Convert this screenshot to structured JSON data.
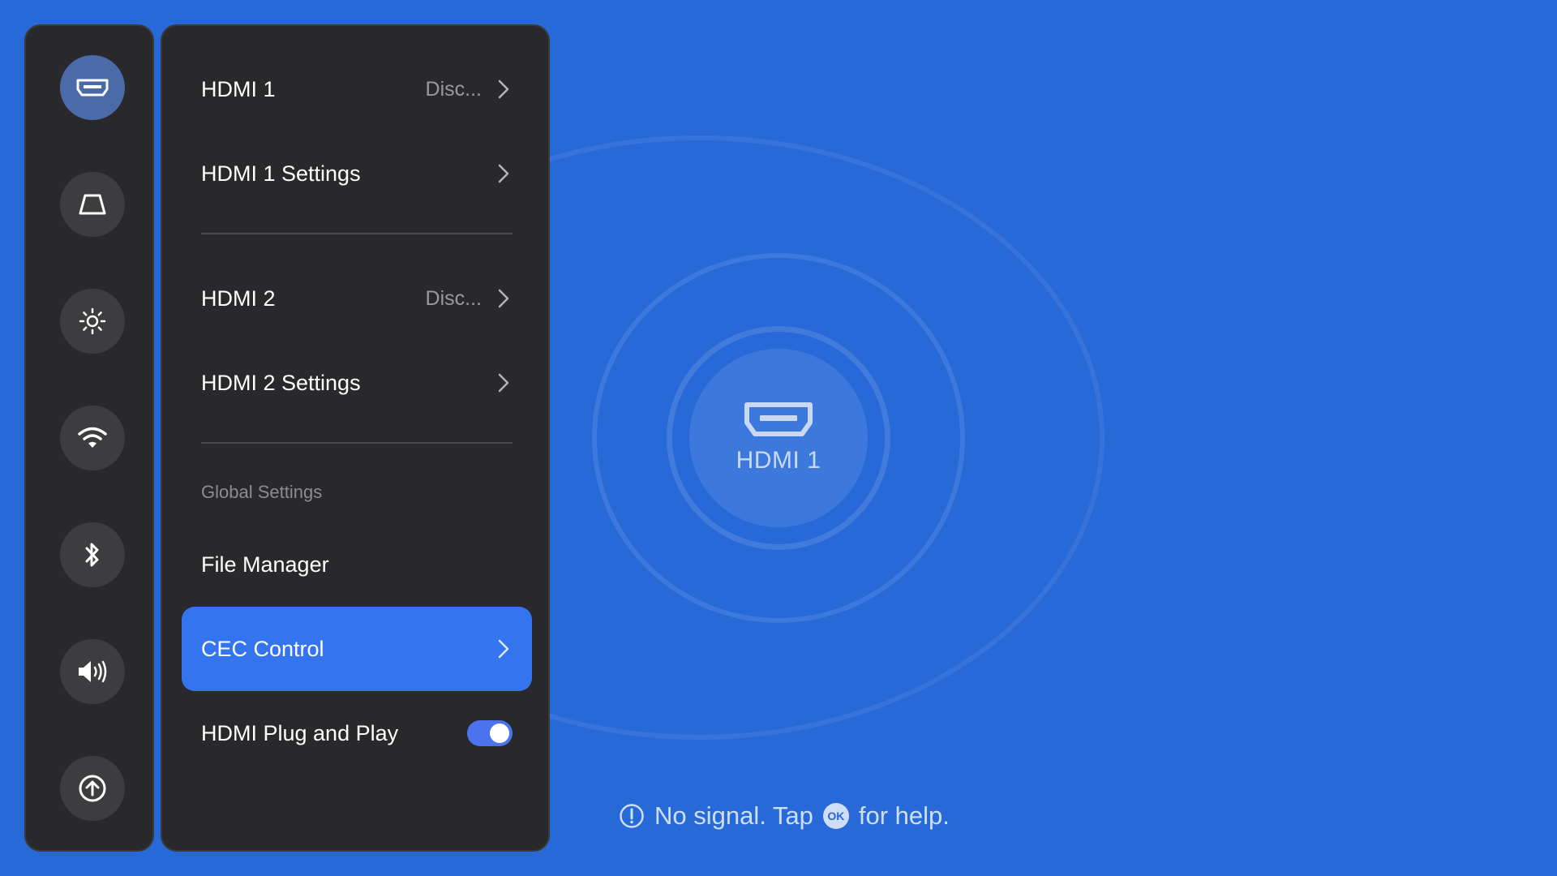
{
  "colors": {
    "background": "#2869d8",
    "panel": "#29292b",
    "selected": "#3474ef",
    "toggle_on": "#4b73ee"
  },
  "rail": {
    "items": [
      {
        "icon": "hdmi-input-icon",
        "active": true
      },
      {
        "icon": "keystone-icon",
        "active": false
      },
      {
        "icon": "brightness-icon",
        "active": false
      },
      {
        "icon": "wifi-icon",
        "active": false
      },
      {
        "icon": "bluetooth-icon",
        "active": false
      },
      {
        "icon": "volume-icon",
        "active": false
      },
      {
        "icon": "upload-icon",
        "active": false
      }
    ]
  },
  "menu": {
    "hdmi1": {
      "label": "HDMI 1",
      "value": "Disc..."
    },
    "hdmi1_settings": {
      "label": "HDMI 1 Settings"
    },
    "hdmi2": {
      "label": "HDMI 2",
      "value": "Disc..."
    },
    "hdmi2_settings": {
      "label": "HDMI 2 Settings"
    },
    "section_label": "Global Settings",
    "file_manager": {
      "label": "File Manager"
    },
    "cec_control": {
      "label": "CEC Control",
      "selected": true
    },
    "plug_and_play": {
      "label": "HDMI Plug and Play",
      "enabled": true
    }
  },
  "center": {
    "source_label": "HDMI 1",
    "icon": "hdmi-icon"
  },
  "hint": {
    "prefix": "No signal. Tap",
    "badge": "OK",
    "suffix": "for help."
  }
}
